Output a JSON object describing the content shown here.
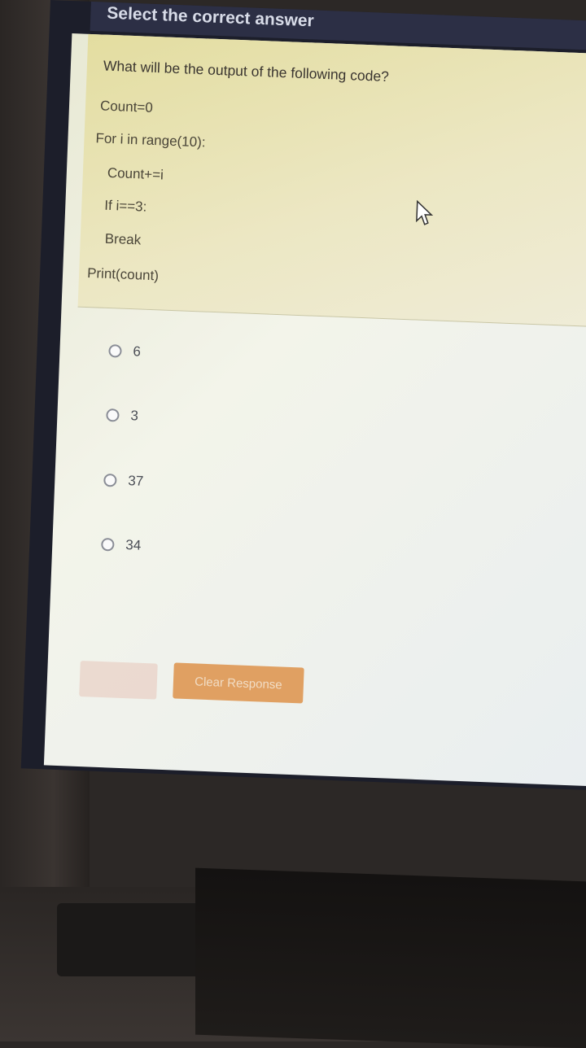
{
  "header": {
    "title": "Select the correct answer"
  },
  "question": {
    "prompt": "What will be the output of the following code?",
    "code_lines": [
      "Count=0",
      "For i in range(10):",
      "Count+=i",
      "If i==3:",
      "Break",
      "Print(count)"
    ]
  },
  "options": [
    {
      "label": "6"
    },
    {
      "label": "3"
    },
    {
      "label": "37"
    },
    {
      "label": "34"
    }
  ],
  "actions": {
    "clear_label": "Clear Response"
  },
  "icons": {
    "radio": "radio-unchecked-icon",
    "cursor": "mouse-pointer-icon"
  },
  "colors": {
    "title_bar": "#2c2f45",
    "question_bg": "#e3dda0",
    "clear_button": "#e0a062"
  }
}
